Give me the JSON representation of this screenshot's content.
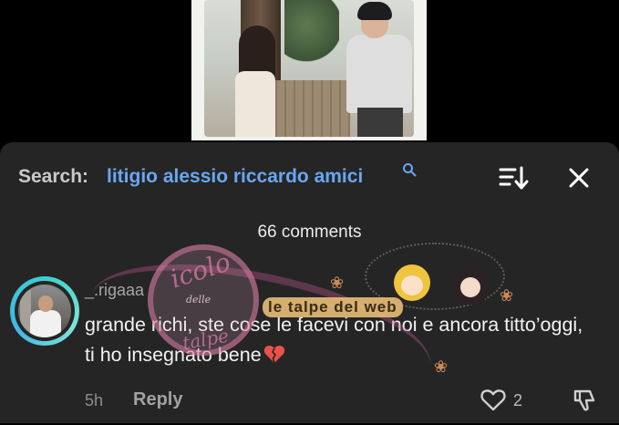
{
  "search": {
    "label": "Search:",
    "query": "litigio alessio riccardo amici"
  },
  "comments_header": {
    "count_label": "66 comments"
  },
  "comment": {
    "username": "_.rigaaa",
    "text": "grande richi, ste cose le facevi con noi e ancora titto’oggi, ti ho insegnato bene",
    "emoji": "broken-heart-emoji",
    "time": "5h",
    "reply_label": "Reply",
    "like_count": "2"
  },
  "watermark": {
    "text_top": "icolo",
    "text_mid": "delle",
    "text_bottom": "talpe",
    "tag": "le talpe del web"
  },
  "colors": {
    "panel_bg": "#252525",
    "link_blue": "#6aa6f0",
    "avatar_ring": "#3bd1ce"
  },
  "icons": {
    "search_query_icon": "search-icon",
    "sort": "sort-icon",
    "close": "close-icon",
    "like": "heart-outline-icon",
    "dislike": "thumbs-down-icon"
  }
}
